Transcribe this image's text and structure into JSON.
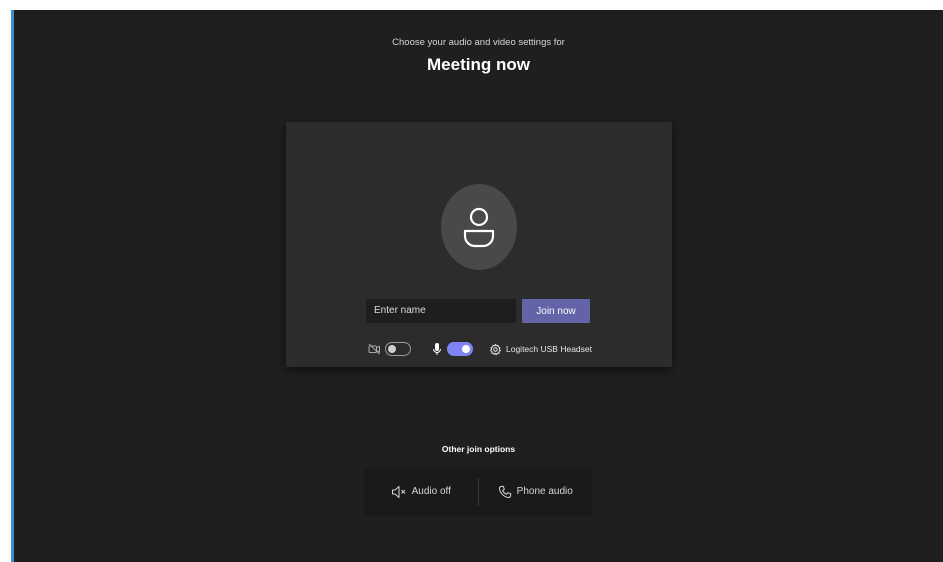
{
  "header": {
    "subtitle": "Choose your audio and video settings for",
    "meeting_title": "Meeting now"
  },
  "prejoin": {
    "name_placeholder": "Enter name",
    "join_label": "Join now",
    "camera_on": false,
    "mic_on": true,
    "audio_device": "Logitech USB Headset"
  },
  "other_options": {
    "heading": "Other join options",
    "audio_off_label": "Audio off",
    "phone_audio_label": "Phone audio"
  },
  "colors": {
    "accent": "#6264a7",
    "toggle_on": "#7f85f5",
    "background": "#201f1f",
    "panel": "#2d2c2c"
  },
  "icons": {
    "avatar": "person-icon",
    "camera": "camera-off-icon",
    "mic": "microphone-icon",
    "settings": "gear-icon",
    "audio_off": "speaker-off-icon",
    "phone": "phone-icon"
  }
}
